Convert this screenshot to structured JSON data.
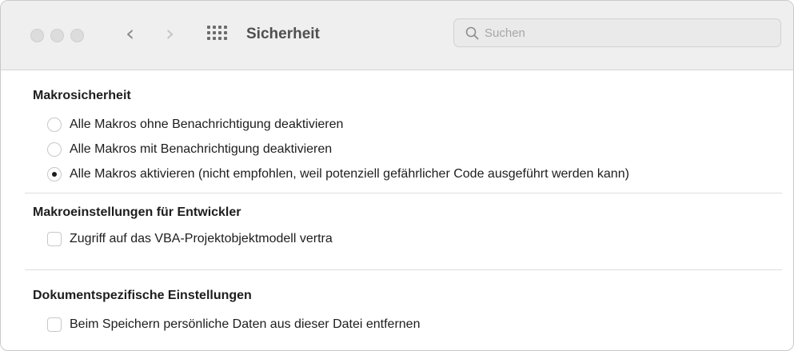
{
  "toolbar": {
    "title": "Sicherheit",
    "back_glyph": "‹",
    "forward_glyph": "›",
    "search": {
      "placeholder": "Suchen",
      "value": ""
    },
    "icons": {
      "traffic_lights": [
        "window-close-icon",
        "window-minimize-icon",
        "window-zoom-icon"
      ],
      "back": "chevron-left-icon",
      "forward": "chevron-right-icon",
      "show_all": "grid-icon",
      "search": "search-icon"
    }
  },
  "sections": {
    "macro_security": {
      "title": "Makrosicherheit",
      "options": [
        {
          "label": "Alle Makros ohne Benachrichtigung deaktivieren",
          "checked": false
        },
        {
          "label": "Alle Makros mit Benachrichtigung deaktivieren",
          "checked": false
        },
        {
          "label": "Alle Makros aktivieren (nicht empfohlen, weil potenziell gefährlicher Code ausgeführt werden kann)",
          "checked": true
        }
      ]
    },
    "developer": {
      "title": "Makroeinstellungen für Entwickler",
      "checkbox_label": "Zugriff auf das VBA-Projektobjektmodell vertra",
      "checked": false
    },
    "document": {
      "title": "Dokumentspezifische Einstellungen",
      "checkbox_label": "Beim Speichern persönliche Daten aus dieser Datei entfernen",
      "checked": false
    }
  },
  "colors": {
    "toolbar_bg": "#efefef",
    "traffic_light": "#dcdcdc",
    "divider": "#dedede"
  }
}
